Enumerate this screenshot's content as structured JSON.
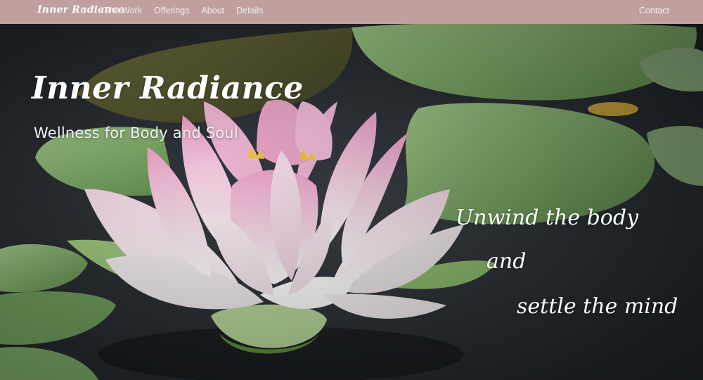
{
  "nav": {
    "background": "#bfa09f",
    "brand": "Inner Radiance",
    "links": [
      "The Work",
      "Offerings",
      "About",
      "Details"
    ],
    "contact": "Contact"
  },
  "hero": {
    "title": "Inner Radiance",
    "subtitle": "Wellness for Body and Soul",
    "tagline": [
      "Unwind the body",
      "and",
      "settle the mind"
    ],
    "image_name": "pink-lotus-flower-on-pond-image"
  },
  "colors": {
    "water": "#2b3036",
    "lily_pad": "#7faa6a",
    "petal": "#f3e9ef",
    "petal_pink": "#e8a9c8"
  }
}
